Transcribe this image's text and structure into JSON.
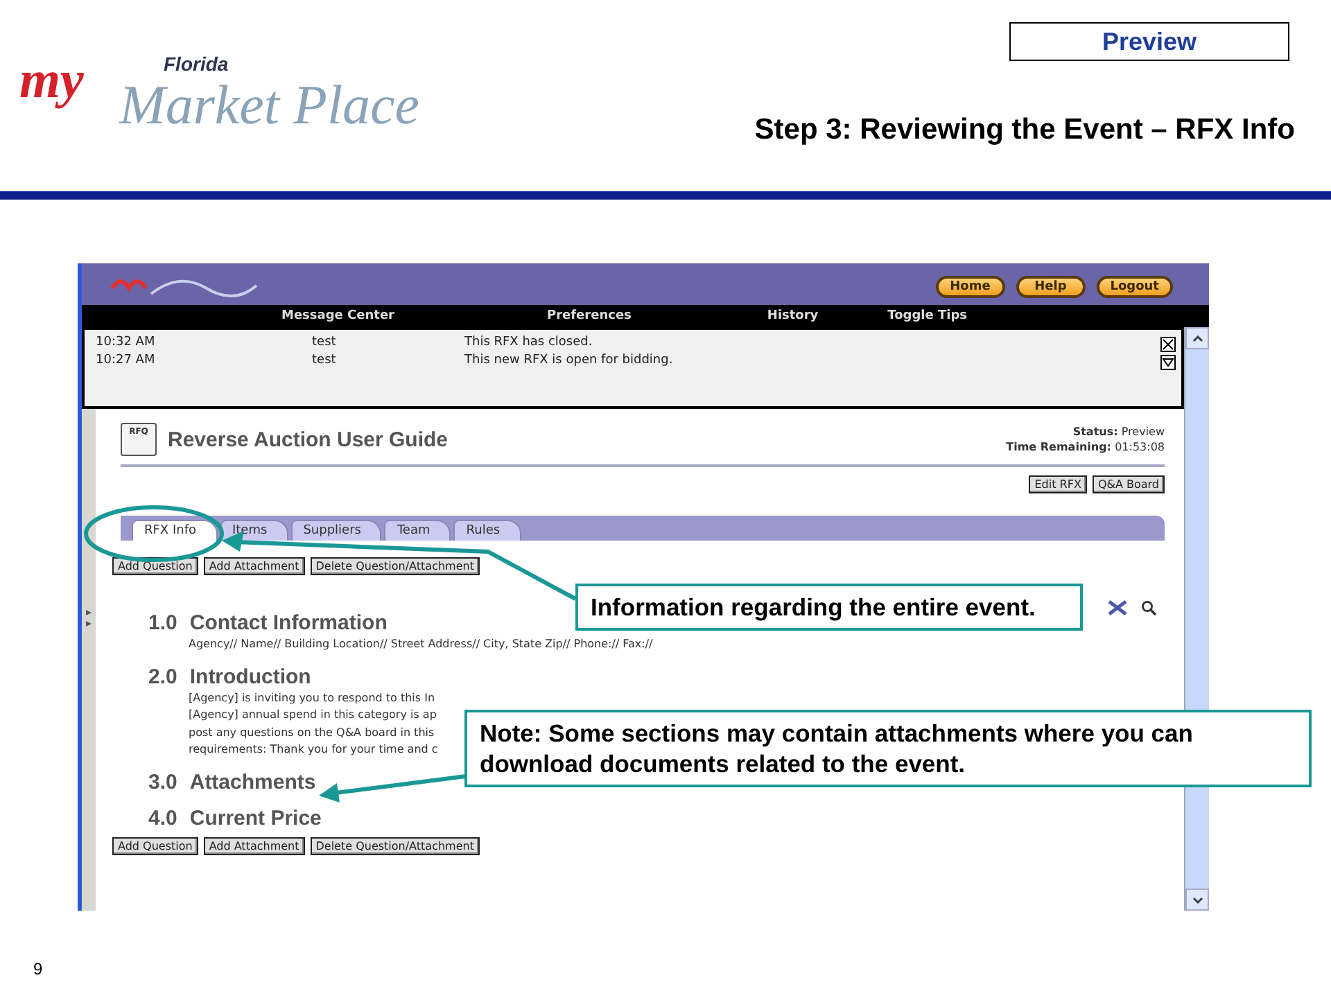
{
  "slide": {
    "logo": {
      "prefix": "my",
      "state": "Florida",
      "name": "Market Place"
    },
    "badge": "Preview",
    "title": "Step 3: Reviewing the Event – RFX Info",
    "page_number": "9"
  },
  "app": {
    "header_buttons": [
      "Home",
      "Help",
      "Logout"
    ],
    "nav": [
      "Message Center",
      "Preferences",
      "History",
      "Toggle Tips"
    ],
    "messages": [
      {
        "time": "10:32 AM",
        "sender": "test",
        "text": "This RFX has closed."
      },
      {
        "time": "10:27 AM",
        "sender": "test",
        "text": "This new RFX is open for bidding."
      }
    ],
    "event": {
      "icon_label": "RFQ",
      "title": "Reverse Auction User Guide",
      "status_label": "Status:",
      "status": "Preview",
      "time_label": "Time Remaining:",
      "time": "01:53:08"
    },
    "actions": [
      "Edit RFX",
      "Q&A Board"
    ],
    "tabs": [
      {
        "label": "RFX Info",
        "selected": true
      },
      {
        "label": "Items",
        "selected": false
      },
      {
        "label": "Suppliers",
        "selected": false
      },
      {
        "label": "Team",
        "selected": false
      },
      {
        "label": "Rules",
        "selected": false
      }
    ],
    "toolbar_buttons": [
      "Add Question",
      "Add Attachment",
      "Delete Question/Attachment"
    ],
    "sections": [
      {
        "number": "1.0",
        "title": "Contact Information",
        "body": [
          "Agency// Name// Building Location// Street Address// City, State Zip// Phone:// Fax://"
        ]
      },
      {
        "number": "2.0",
        "title": "Introduction",
        "body": [
          "[Agency] is inviting you to respond to this In",
          "[Agency] annual spend in this category is ap",
          "post any questions on the Q&A board in this",
          "requirements: Thank you for your time and c"
        ]
      },
      {
        "number": "3.0",
        "title": "Attachments"
      },
      {
        "number": "4.0",
        "title": "Current Price"
      }
    ],
    "bottom_buttons": [
      "Add Question",
      "Add Attachment",
      "Delete Question/Attachment"
    ]
  },
  "callouts": [
    {
      "text": "Information regarding the entire event."
    },
    {
      "text": "Note: Some sections may contain attachments where you can download documents related to the event."
    }
  ]
}
